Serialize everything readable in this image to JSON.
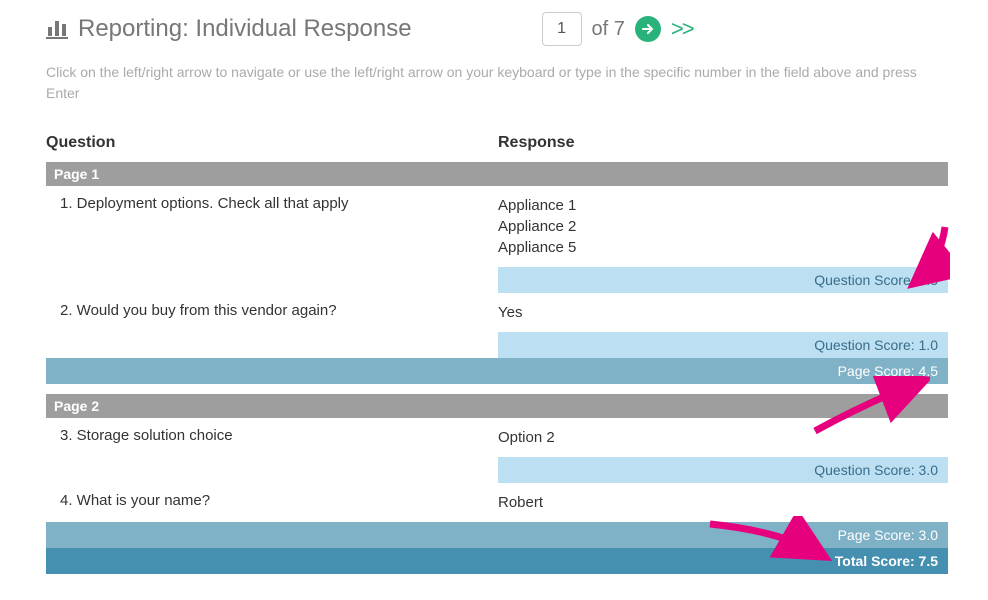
{
  "header": {
    "title": "Reporting: Individual Response",
    "page_input": "1",
    "of_label": "of",
    "total_pages": "7",
    "next_arrows": ">>"
  },
  "helper_text": "Click on the left/right arrow to navigate or use the left/right arrow on your keyboard or type in the specific number in the field above and press Enter",
  "labels": {
    "question": "Question",
    "response": "Response",
    "q_score_prefix": "Question Score: ",
    "p_score_prefix": "Page Score: ",
    "t_score_prefix": "Total Score: "
  },
  "pages": [
    {
      "title": "Page 1",
      "rows": [
        {
          "q": "1. Deployment options.  Check all that apply",
          "r": "Appliance 1\nAppliance 2\nAppliance 5",
          "score": "3.5"
        },
        {
          "q": "2. Would you buy from this vendor again?",
          "r": "Yes",
          "score": "1.0"
        }
      ],
      "page_score": "4.5"
    },
    {
      "title": "Page 2",
      "rows": [
        {
          "q": "3. Storage solution choice",
          "r": "Option 2",
          "score": "3.0"
        },
        {
          "q": "4. What is your name?",
          "r": "Robert",
          "score": null
        }
      ],
      "page_score": "3.0"
    }
  ],
  "total_score": "7.5"
}
